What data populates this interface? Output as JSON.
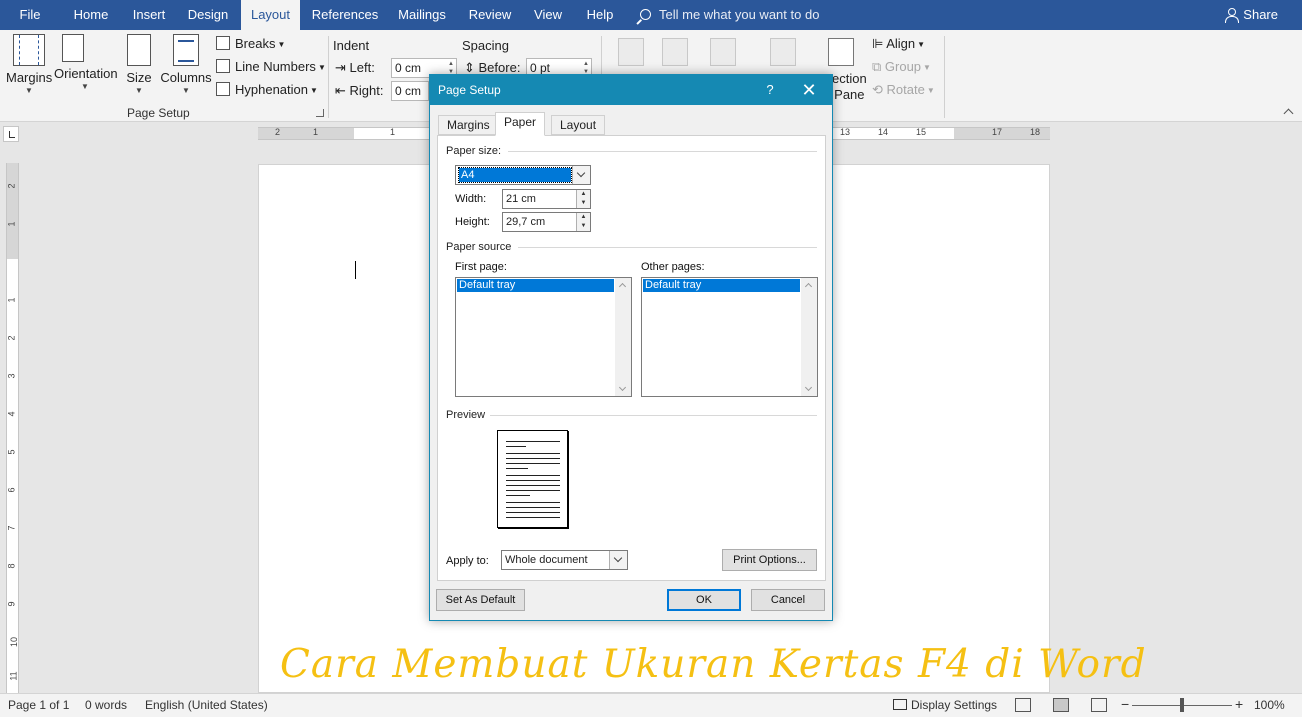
{
  "ribbon_tabs": {
    "file": "File",
    "home": "Home",
    "insert": "Insert",
    "design": "Design",
    "layout": "Layout",
    "references": "References",
    "mailings": "Mailings",
    "review": "Review",
    "view": "View",
    "help": "Help"
  },
  "tell_me": "Tell me what you want to do",
  "share": "Share",
  "page_setup_group": {
    "margins": "Margins",
    "orientation": "Orientation",
    "size": "Size",
    "columns": "Columns",
    "breaks": "Breaks",
    "line_numbers": "Line Numbers",
    "hyphenation": "Hyphenation",
    "label": "Page Setup"
  },
  "paragraph_group": {
    "indent": "Indent",
    "spacing": "Spacing",
    "left_label": "Left:",
    "left_value": "0 cm",
    "right_label": "Right:",
    "right_value": "0 cm",
    "before_label": "Before:",
    "before_value": "0 pt"
  },
  "arrange_group": {
    "selection_pane_line1": "ection",
    "selection_pane_line2": "Pane",
    "align": "Align",
    "group": "Group",
    "rotate": "Rotate"
  },
  "ruler": {
    "h_numbers": [
      "2",
      "1",
      "1",
      "13",
      "14",
      "15",
      "17",
      "18"
    ],
    "v_numbers": [
      "2",
      "1",
      "1",
      "2",
      "3",
      "4",
      "5",
      "6",
      "7",
      "8",
      "9",
      "10",
      "11"
    ]
  },
  "dialog": {
    "title": "Page Setup",
    "help": "?",
    "close": "✕",
    "tabs": {
      "margins": "Margins",
      "paper": "Paper",
      "layout": "Layout"
    },
    "paper_size_heading": "Paper size:",
    "paper_size_value": "A4",
    "width_label": "Width:",
    "width_value": "21 cm",
    "height_label": "Height:",
    "height_value": "29,7 cm",
    "paper_source_heading": "Paper source",
    "first_page_label": "First page:",
    "first_page_item": "Default tray",
    "other_pages_label": "Other pages:",
    "other_pages_item": "Default tray",
    "preview_heading": "Preview",
    "apply_to_label": "Apply to:",
    "apply_to_value": "Whole document",
    "print_options": "Print Options...",
    "set_as_default": "Set As Default",
    "ok": "OK",
    "cancel": "Cancel"
  },
  "caption": "Cara Membuat Ukuran Kertas F4 di Word",
  "status_bar": {
    "page": "Page 1 of 1",
    "words": "0 words",
    "language": "English (United States)",
    "display_settings": "Display Settings",
    "zoom_minus": "−",
    "zoom_plus": "+",
    "zoom": "100%",
    "zoom_level": 1.0
  },
  "colors": {
    "ribbon_blue": "#2b579a",
    "dialog_title": "#1589b3",
    "selection": "#0078d7",
    "caption": "#f5c013"
  }
}
